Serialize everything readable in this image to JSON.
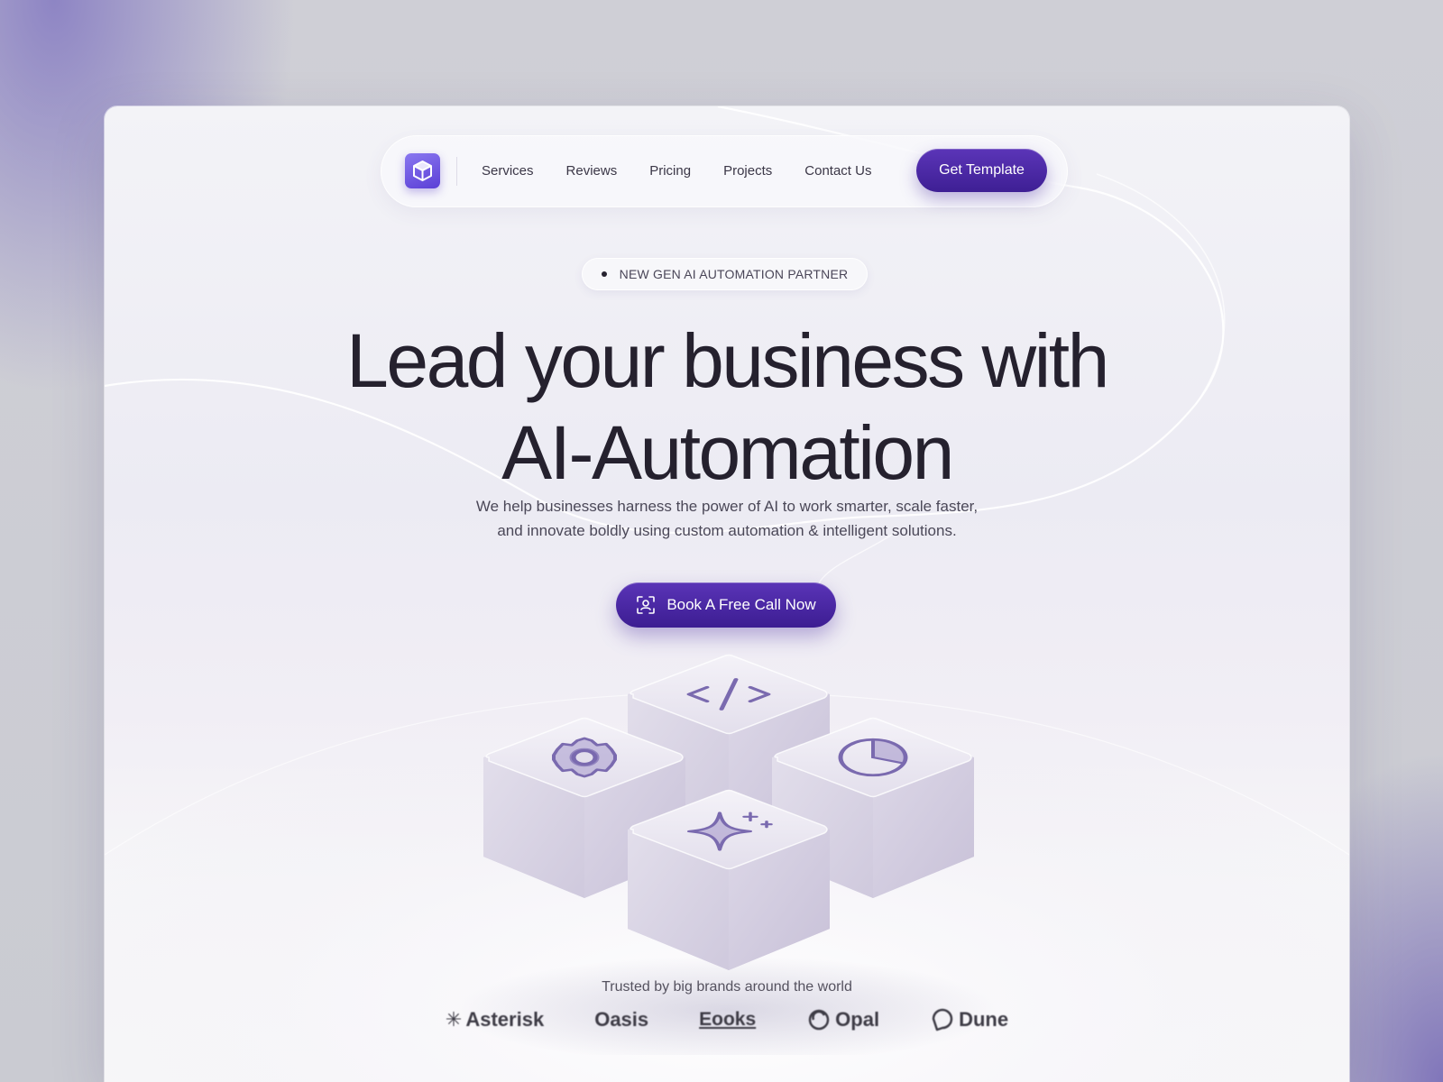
{
  "nav": {
    "links": [
      "Services",
      "Reviews",
      "Pricing",
      "Projects",
      "Contact Us"
    ],
    "cta_label": "Get Template"
  },
  "hero": {
    "badge": "NEW GEN AI AUTOMATION PARTNER",
    "headline_line1": "Lead your business with",
    "headline_line2": "AI-Automation",
    "subtitle_line1": "We help businesses harness the power of AI to work smarter, scale faster,",
    "subtitle_line2": "and innovate boldly using custom automation & intelligent solutions.",
    "cta_label": "Book A Free Call Now"
  },
  "cubes": {
    "icons": [
      "code-icon",
      "gear-icon",
      "pie-chart-icon",
      "sparkle-icon"
    ]
  },
  "trusted": {
    "label": "Trusted by big brands around the world",
    "brands": [
      {
        "name": "Asterisk",
        "icon": "asterisk-logo-icon"
      },
      {
        "name": "Oasis",
        "icon": ""
      },
      {
        "name": "Eooks",
        "icon": ""
      },
      {
        "name": "Opal",
        "icon": "opal-logo-icon"
      },
      {
        "name": "Dune",
        "icon": "dune-logo-icon"
      }
    ]
  },
  "colors": {
    "accent": "#4a27a6",
    "text_dark": "#25212e",
    "cube_face": "#e6e3ef",
    "icon_purple": "#7a6aaf"
  }
}
